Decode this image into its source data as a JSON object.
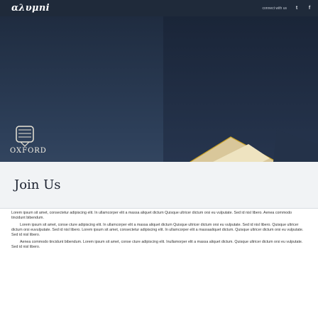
{
  "header": {
    "brand": "αλυμni",
    "connect_label": "connect with us",
    "social": [
      {
        "icon": "twitter-icon",
        "glyph": "t"
      },
      {
        "icon": "facebook-icon",
        "glyph": "f"
      }
    ]
  },
  "hero": {
    "logo_label": "OXFORD",
    "join_title": "Join Us"
  },
  "content": {
    "paragraphs": [
      "Lorem ipsum sit amet, consectetur adipiscing elit. In ullamcorper elit a massa aliquet dictum Quisque ultricer dictum orsi eu vulputate. Sed id nisl libero. Aenea commodo tincidunt bibendum.",
      "Lorem ipsum sit amet, conse cture adipiscing elit. In ullamcorper elit a massa aliquet dictum Quisque ultricer dictum orsi eu vulputate. Sed id nisl libero. Quisque ultricer dictum orsi euvulputate. Sed id nisl libero. Lorem ipsum sit amet, consectetur adipiscing elit. In ullamcorper elit a massaaliquet dictum. Quisque ultricer dictum orsi eu vulputate. Sed id nisl libero.",
      "Aenea commodo tincidunt bibendum. Lorem ipsum sit amet, conse cture adipiscing elit. Inullamorper elit a massa aliquet dictum. Quisque ultricer dictum orsi eu vulputate. Sed id nisl libero."
    ]
  },
  "colors": {
    "topbar": "#1f2a3a",
    "hero_dark": "#1b2738",
    "gold": "#c9a227",
    "text": "#333333"
  }
}
